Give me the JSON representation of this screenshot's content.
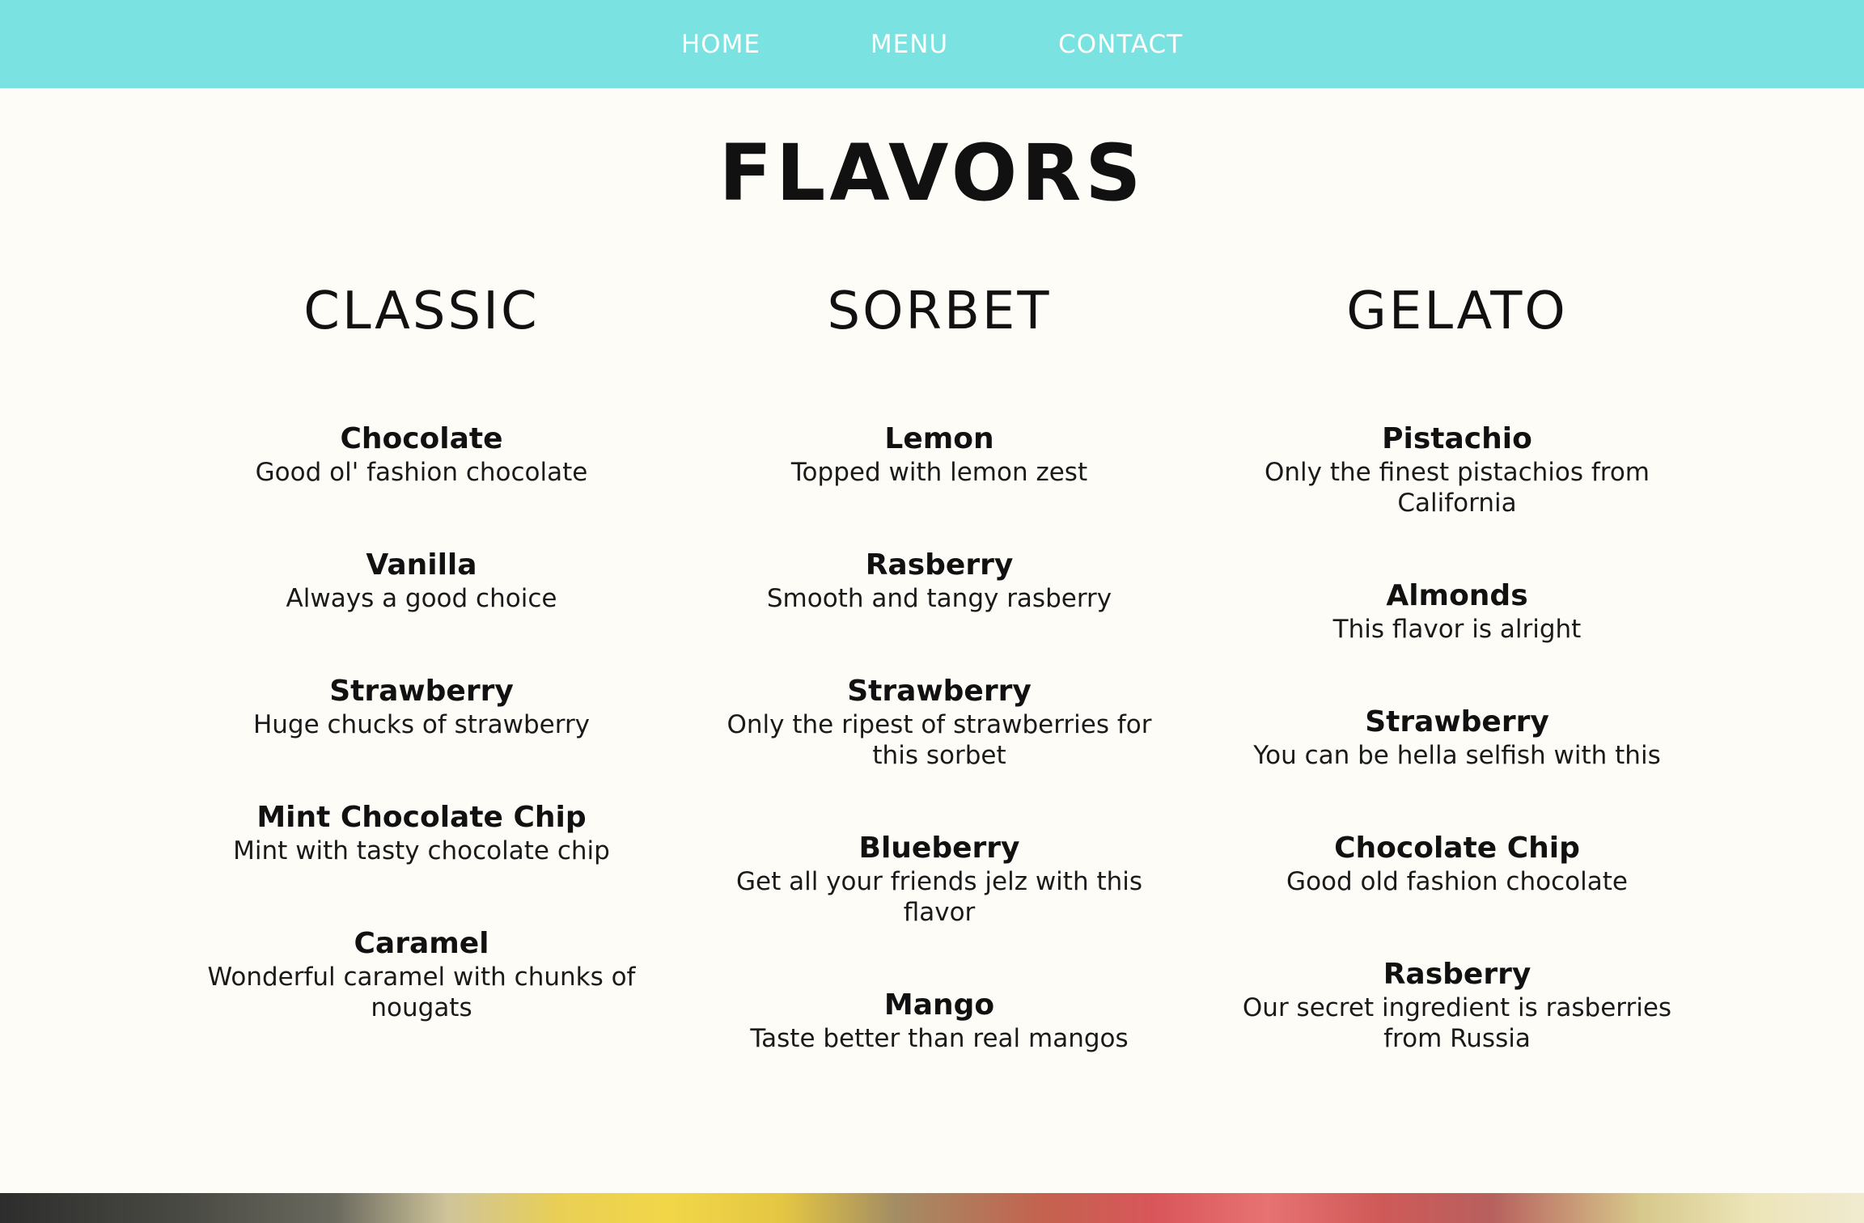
{
  "nav": {
    "items": [
      {
        "label": "HOME"
      },
      {
        "label": "MENU"
      },
      {
        "label": "CONTACT"
      }
    ]
  },
  "page_title": "FLAVORS",
  "columns": [
    {
      "title": "CLASSIC",
      "flavors": [
        {
          "name": "Chocolate",
          "desc": "Good ol' fashion chocolate"
        },
        {
          "name": "Vanilla",
          "desc": "Always a good choice"
        },
        {
          "name": "Strawberry",
          "desc": "Huge chucks of strawberry"
        },
        {
          "name": "Mint Chocolate Chip",
          "desc": "Mint with tasty chocolate chip"
        },
        {
          "name": "Caramel",
          "desc": "Wonderful caramel with chunks of nougats"
        }
      ]
    },
    {
      "title": "SORBET",
      "flavors": [
        {
          "name": "Lemon",
          "desc": "Topped with lemon zest"
        },
        {
          "name": "Rasberry",
          "desc": "Smooth and tangy rasberry"
        },
        {
          "name": "Strawberry",
          "desc": "Only the ripest of strawberries for this sorbet"
        },
        {
          "name": "Blueberry",
          "desc": "Get all your friends jelz with this flavor"
        },
        {
          "name": "Mango",
          "desc": "Taste better than real mangos"
        }
      ]
    },
    {
      "title": "GELATO",
      "flavors": [
        {
          "name": "Pistachio",
          "desc": "Only the finest pistachios from California"
        },
        {
          "name": "Almonds",
          "desc": "This flavor is alright"
        },
        {
          "name": "Strawberry",
          "desc": "You can be hella selfish with this"
        },
        {
          "name": "Chocolate Chip",
          "desc": "Good old fashion chocolate"
        },
        {
          "name": "Rasberry",
          "desc": "Our secret ingredient is rasberries from Russia"
        }
      ]
    }
  ],
  "colors": {
    "nav_background": "#7ae2e0",
    "page_background": "#fdfcf7",
    "nav_text": "#ffffff",
    "body_text": "#111111"
  }
}
